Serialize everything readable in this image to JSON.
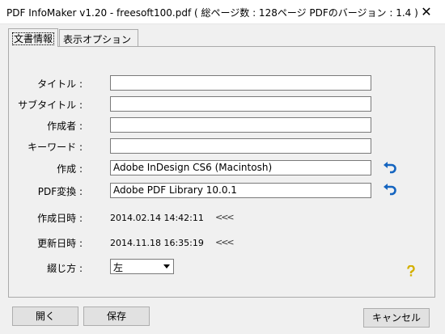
{
  "window": {
    "title": "PDF InfoMaker v1.20 - freesoft100.pdf ( 総ページ数 : 128ページ PDFのバージョン : 1.4 )",
    "close_glyph": "✕"
  },
  "tabs": [
    {
      "label": "文書情報"
    },
    {
      "label": "表示オプション"
    }
  ],
  "fields": {
    "title": {
      "label": "タイトル :",
      "value": ""
    },
    "subtitle": {
      "label": "サブタイトル :",
      "value": ""
    },
    "author": {
      "label": "作成者 :",
      "value": ""
    },
    "keywords": {
      "label": "キーワード :",
      "value": ""
    },
    "creator": {
      "label": "作成 :",
      "value": "Adobe InDesign CS6 (Macintosh)"
    },
    "producer": {
      "label": "PDF変換 :",
      "value": "Adobe PDF Library 10.0.1"
    }
  },
  "dates": {
    "created": {
      "label": "作成日時 :",
      "value": "2014.02.14  14:42:11",
      "arrows": "<<<"
    },
    "modified": {
      "label": "更新日時 :",
      "value": "2014.11.18  16:35:19",
      "arrows": "<<<"
    }
  },
  "binding": {
    "label": "綴じ方 :",
    "selected": "左"
  },
  "buttons": {
    "open": "開く",
    "save": "保存",
    "cancel": "キャンセル"
  },
  "colors": {
    "undo_icon": "#1565c0",
    "help_icon": "#d4b000"
  }
}
